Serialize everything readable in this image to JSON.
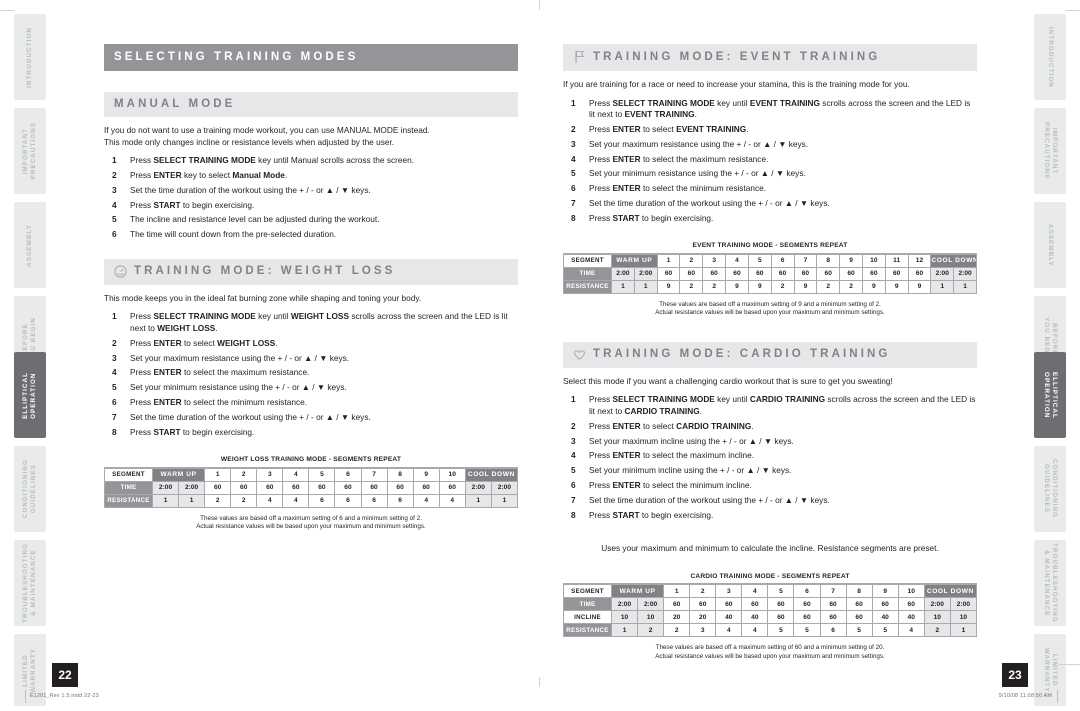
{
  "sidebar_left": {
    "items": [
      {
        "label": "INTRODUCTION",
        "active": false
      },
      {
        "label": "IMPORTANT\nPRECAUTIONS",
        "active": false
      },
      {
        "label": "ASSEMBLY",
        "active": false
      },
      {
        "label": "BEFORE\nYOU BEGIN",
        "active": false
      },
      {
        "label": "ELLIPTICAL\nOPERATION",
        "active": true
      },
      {
        "label": "CONDITIONING\nGUIDELINES",
        "active": false
      },
      {
        "label": "TROUBLESHOOTING\n& MAINTENANCE",
        "active": false
      },
      {
        "label": "LIMITED\nWARRANTY",
        "active": false
      }
    ]
  },
  "sidebar_right": {
    "items": [
      {
        "label": "INTRODUCTION",
        "active": false
      },
      {
        "label": "IMPORTANT\nPRECAUTIONS",
        "active": false
      },
      {
        "label": "ASSEMBLY",
        "active": false
      },
      {
        "label": "BEFORE\nYOU BEGIN",
        "active": false
      },
      {
        "label": "ELLIPTICAL\nOPERATION",
        "active": true
      },
      {
        "label": "CONDITIONING\nGUIDELINES",
        "active": false
      },
      {
        "label": "TROUBLESHOOTING\n& MAINTENANCE",
        "active": false
      },
      {
        "label": "LIMITED\nWARRANTY",
        "active": false
      }
    ]
  },
  "left_page": {
    "page_number": "22",
    "main_heading": "SELECTING TRAINING MODES",
    "manual": {
      "heading": "MANUAL MODE",
      "intro_line1": "If you do not want to use a training mode workout, you can use MANUAL MODE instead.",
      "intro_line2": "This mode only changes incline or resistance levels when adjusted by the user.",
      "steps": [
        "Press SELECT TRAINING MODE key until Manual scrolls across the screen.",
        "Press ENTER key to select Manual Mode.",
        "Set the time duration of the workout using the + / - or ▲ / ▼ keys.",
        "Press START to begin exercising.",
        "The incline and resistance level can be adjusted during the workout.",
        "The time will count down from the pre-selected duration."
      ]
    },
    "weight_loss": {
      "heading": "TRAINING MODE: WEIGHT LOSS",
      "icon": "speedometer-icon",
      "intro": "This mode keeps you in the ideal fat burning zone while shaping and toning your body.",
      "steps": [
        "Press SELECT TRAINING MODE key until WEIGHT LOSS scrolls across the screen and the LED is lit next to WEIGHT LOSS.",
        "Press ENTER to select WEIGHT LOSS.",
        "Set your maximum resistance using the + / - or ▲ / ▼ keys.",
        "Press ENTER to select the maximum resistance.",
        "Set your minimum resistance using the + / - or ▲ / ▼ keys.",
        "Press ENTER to select the minimum resistance.",
        "Set the time duration of the workout using the + / - or ▲ / ▼ keys.",
        "Press START to begin exercising."
      ],
      "note_line1": "These values are based off a maximum setting of 6 and a minimum setting of 2.",
      "note_line2": "Actual resistance values will be based upon your maximum and minimum settings."
    }
  },
  "right_page": {
    "page_number": "23",
    "event": {
      "heading": "TRAINING MODE: EVENT TRAINING",
      "icon": "flag-icon",
      "intro": "If you are training for a race or need to increase your stamina, this is the training mode for you.",
      "steps": [
        "Press SELECT TRAINING MODE key until EVENT TRAINING scrolls across the screen and the LED is lit next to EVENT TRAINING.",
        "Press ENTER to select EVENT TRAINING.",
        "Set your maximum resistance using the + / - or ▲ / ▼ keys.",
        "Press ENTER to select the maximum resistance.",
        "Set your minimum resistance using the + / - or ▲ / ▼ keys.",
        "Press ENTER to select the minimum resistance.",
        "Set the time duration of the workout using the + / - or ▲ / ▼ keys.",
        "Press START to begin exercising."
      ],
      "note_line1": "These values are based off a maximum setting of 9 and a minimum setting of 2.",
      "note_line2": "Actual resistance values will be based upon your maximum and minimum settings."
    },
    "cardio": {
      "heading": "TRAINING MODE: CARDIO TRAINING",
      "icon": "heart-icon",
      "intro": "Select this mode if you want a challenging cardio workout that is sure to get you sweating!",
      "steps": [
        "Press SELECT TRAINING MODE key until CARDIO TRAINING scrolls across the screen and the LED is lit next to CARDIO TRAINING.",
        "Press ENTER to select CARDIO TRAINING.",
        "Set your maximum incline using the + / - or ▲ / ▼ keys.",
        "Press ENTER to select the maximum incline.",
        "Set your minimum incline using the + / - or ▲ / ▼ keys.",
        "Press ENTER to select the minimum incline.",
        "Set the time duration of the workout using the + / - or ▲ / ▼ keys.",
        "Press START to begin exercising."
      ],
      "mid_note": "Uses your maximum and minimum to calculate the incline. Resistance segments are preset.",
      "note_line1": "These values are based off a maximum setting of 60 and a minimum setting of 20.",
      "note_line2": "Actual resistance values will be based upon your maximum and minimum settings."
    }
  },
  "chart_data": [
    {
      "type": "table",
      "id": "weight-loss-segments",
      "title": "WEIGHT LOSS TRAINING MODE - SEGMENTS REPEAT",
      "row_headers": [
        "SEGMENT",
        "TIME",
        "RESISTANCE"
      ],
      "segments": [
        "WARM UP",
        "WARM UP",
        "1",
        "2",
        "3",
        "4",
        "5",
        "6",
        "7",
        "8",
        "9",
        "10",
        "COOL DOWN",
        "COOL DOWN"
      ],
      "segment_bands": [
        {
          "label": "WARM UP",
          "span": 2
        },
        {
          "label": "1",
          "span": 1
        },
        {
          "label": "2",
          "span": 1
        },
        {
          "label": "3",
          "span": 1
        },
        {
          "label": "4",
          "span": 1
        },
        {
          "label": "5",
          "span": 1
        },
        {
          "label": "6",
          "span": 1
        },
        {
          "label": "7",
          "span": 1
        },
        {
          "label": "8",
          "span": 1
        },
        {
          "label": "9",
          "span": 1
        },
        {
          "label": "10",
          "span": 1
        },
        {
          "label": "COOL DOWN",
          "span": 2
        }
      ],
      "time": [
        "2:00",
        "2:00",
        "60",
        "60",
        "60",
        "60",
        "60",
        "60",
        "60",
        "60",
        "60",
        "60",
        "2:00",
        "2:00"
      ],
      "resistance": [
        "1",
        "1",
        "2",
        "2",
        "4",
        "4",
        "6",
        "6",
        "6",
        "6",
        "4",
        "4",
        "1",
        "1"
      ]
    },
    {
      "type": "table",
      "id": "event-training-segments",
      "title": "EVENT TRAINING MODE - SEGMENTS REPEAT",
      "row_headers": [
        "SEGMENT",
        "TIME",
        "RESISTANCE"
      ],
      "segment_bands": [
        {
          "label": "WARM UP",
          "span": 2
        },
        {
          "label": "1",
          "span": 1
        },
        {
          "label": "2",
          "span": 1
        },
        {
          "label": "3",
          "span": 1
        },
        {
          "label": "4",
          "span": 1
        },
        {
          "label": "5",
          "span": 1
        },
        {
          "label": "6",
          "span": 1
        },
        {
          "label": "7",
          "span": 1
        },
        {
          "label": "8",
          "span": 1
        },
        {
          "label": "9",
          "span": 1
        },
        {
          "label": "10",
          "span": 1
        },
        {
          "label": "11",
          "span": 1
        },
        {
          "label": "12",
          "span": 1
        },
        {
          "label": "COOL DOWN",
          "span": 2
        }
      ],
      "time": [
        "2:00",
        "2:00",
        "60",
        "60",
        "60",
        "60",
        "60",
        "60",
        "60",
        "60",
        "60",
        "60",
        "60",
        "60",
        "2:00",
        "2:00"
      ],
      "resistance": [
        "1",
        "1",
        "9",
        "2",
        "2",
        "9",
        "9",
        "2",
        "9",
        "2",
        "2",
        "9",
        "9",
        "9",
        "1",
        "1"
      ]
    },
    {
      "type": "table",
      "id": "cardio-training-segments",
      "title": "CARDIO TRAINING MODE - SEGMENTS REPEAT",
      "row_headers": [
        "SEGMENT",
        "TIME",
        "INCLINE",
        "RESISTANCE"
      ],
      "segment_bands": [
        {
          "label": "WARM UP",
          "span": 2
        },
        {
          "label": "1",
          "span": 1
        },
        {
          "label": "2",
          "span": 1
        },
        {
          "label": "3",
          "span": 1
        },
        {
          "label": "4",
          "span": 1
        },
        {
          "label": "5",
          "span": 1
        },
        {
          "label": "6",
          "span": 1
        },
        {
          "label": "7",
          "span": 1
        },
        {
          "label": "8",
          "span": 1
        },
        {
          "label": "9",
          "span": 1
        },
        {
          "label": "10",
          "span": 1
        },
        {
          "label": "COOL DOWN",
          "span": 2
        }
      ],
      "time": [
        "2:00",
        "2:00",
        "60",
        "60",
        "60",
        "60",
        "60",
        "60",
        "60",
        "60",
        "60",
        "60",
        "2:00",
        "2:00"
      ],
      "incline": [
        "10",
        "10",
        "20",
        "20",
        "40",
        "40",
        "60",
        "60",
        "60",
        "60",
        "40",
        "40",
        "10",
        "10"
      ],
      "resistance": [
        "1",
        "2",
        "2",
        "3",
        "4",
        "4",
        "5",
        "5",
        "6",
        "5",
        "5",
        "4",
        "2",
        "1"
      ]
    }
  ],
  "footer": {
    "file_info": "E1201_Rev 1.5.indd   22-23",
    "timestamp": "9/10/08   11:08:50 AM"
  }
}
